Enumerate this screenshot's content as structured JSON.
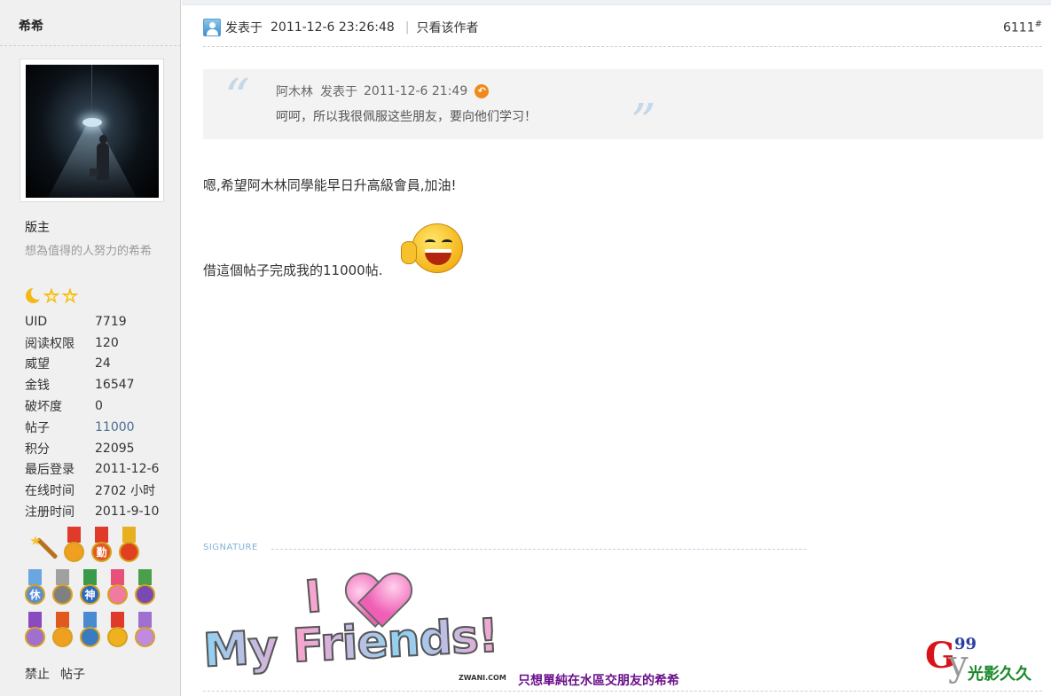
{
  "sidebar": {
    "username": "希希",
    "rank_title": "版主",
    "custom_title": "想為值得的人努力的希希",
    "stats": [
      {
        "key": "UID",
        "value": "7719",
        "link": false
      },
      {
        "key": "阅读权限",
        "value": "120",
        "link": false
      },
      {
        "key": "威望",
        "value": "24",
        "link": false
      },
      {
        "key": "金钱",
        "value": "16547",
        "link": false
      },
      {
        "key": "破坏度",
        "value": "0",
        "link": false
      },
      {
        "key": "帖子",
        "value": "11000",
        "link": true
      },
      {
        "key": "积分",
        "value": "22095",
        "link": false
      },
      {
        "key": "最后登录",
        "value": "2011-12-6",
        "link": false
      },
      {
        "key": "在线时间",
        "value": "2702 小时",
        "link": false
      },
      {
        "key": "注册时间",
        "value": "2011-9-10",
        "link": false
      }
    ],
    "medals": {
      "row1": [
        {
          "icon": "magic-wand-medal-icon"
        },
        {
          "icon": "medal-icon",
          "ribbon": "#e03a2a",
          "disc": "#f0a020",
          "text": ""
        },
        {
          "icon": "medal-icon",
          "ribbon": "#e03a2a",
          "disc": "#e05a20",
          "text": "勤"
        },
        {
          "icon": "medal-icon",
          "ribbon": "#e8b020",
          "disc": "#e0401f",
          "text": ""
        }
      ],
      "row2": [
        {
          "icon": "medal-icon",
          "ribbon": "#6aa6e0",
          "disc": "#5a8fd0",
          "text": "休"
        },
        {
          "icon": "medal-icon",
          "ribbon": "#a0a0a0",
          "disc": "#808080",
          "text": ""
        },
        {
          "icon": "medal-icon",
          "ribbon": "#3a9a4a",
          "disc": "#2a6ac0",
          "text": "神"
        },
        {
          "icon": "medal-icon",
          "ribbon": "#e8507a",
          "disc": "#f07aa0",
          "text": ""
        },
        {
          "icon": "medal-icon",
          "ribbon": "#4aa04a",
          "disc": "#7a4ab0",
          "text": ""
        }
      ],
      "row3": [
        {
          "icon": "medal-icon",
          "ribbon": "#8a4ac0",
          "disc": "#a070d0",
          "text": ""
        },
        {
          "icon": "medal-icon",
          "ribbon": "#e05a20",
          "disc": "#f0a020",
          "text": ""
        },
        {
          "icon": "medal-icon",
          "ribbon": "#4a8ad0",
          "disc": "#3a7ac0",
          "text": ""
        },
        {
          "icon": "medal-icon",
          "ribbon": "#e03a2a",
          "disc": "#f0b020",
          "text": ""
        },
        {
          "icon": "medal-icon",
          "ribbon": "#a070d0",
          "disc": "#c08ae0",
          "text": ""
        }
      ]
    },
    "links": [
      "禁止",
      "帖子"
    ]
  },
  "post": {
    "posted_label": "发表于",
    "posted_time": "2011-12-6 23:26:48",
    "only_author": "只看该作者",
    "floor": "6111",
    "floor_mark": "#",
    "quote": {
      "author": "阿木林",
      "posted_label": "发表于",
      "time": "2011-12-6 21:49",
      "text": "呵呵，所以我很佩服这些朋友，要向他们学习！",
      "open_mark": "“",
      "close_mark": "”"
    },
    "body_line1": "嗯,希望阿木林同學能早日升高級會員,加油!",
    "body_line2": "借這個帖子完成我的11000帖."
  },
  "signature": {
    "label": "SIGNATURE",
    "image_word_i": "I",
    "image_text": "My Friends!",
    "image_brand": "ZWANI.COM",
    "caption": "只想單純在水區交朋友的希希",
    "logo_g": "G",
    "logo_num": "99",
    "logo_y": "y",
    "logo_cn": "光影久久"
  },
  "colors": {
    "sidebar_bg": "#f0f0f0",
    "link": "#4c6d91",
    "quote_bg": "#f3f3f3",
    "caption": "#6a0f8a"
  }
}
